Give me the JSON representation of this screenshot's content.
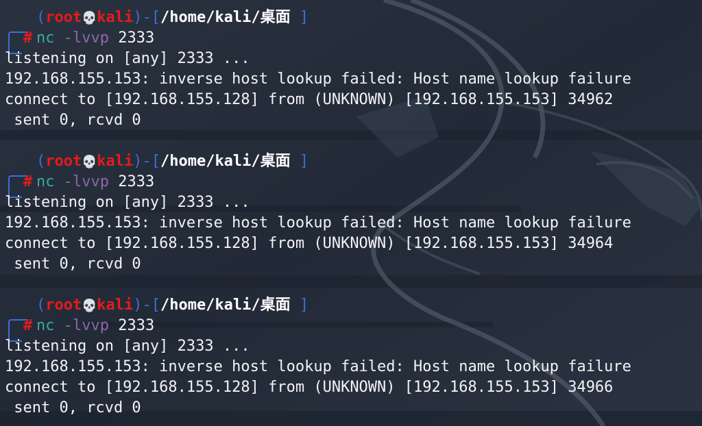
{
  "prompt": {
    "user": "root",
    "skull": "💀",
    "host": "kali",
    "path": "/home/kali/桌面",
    "symbol": "#"
  },
  "icons": {
    "skull": "skull-icon"
  },
  "colors": {
    "background": "#262e3c",
    "frame": "#3b6fd6",
    "user_host": "#e51b1b",
    "command": "#3aa7a7",
    "argument": "#8a6aa6",
    "text": "#f2f3f5"
  },
  "sessions": [
    {
      "command": "nc",
      "flag": "-lvvp",
      "port": "2333",
      "listening": "listening on [any] 2333 ...",
      "lookup": "192.168.155.153: inverse host lookup failed: Host name lookup failure",
      "connect": "connect to [192.168.155.128] from (UNKNOWN) [192.168.155.153] 34962",
      "sent": " sent 0, rcvd 0"
    },
    {
      "command": "nc",
      "flag": "-lvvp",
      "port": "2333",
      "listening": "listening on [any] 2333 ...",
      "lookup": "192.168.155.153: inverse host lookup failed: Host name lookup failure",
      "connect": "connect to [192.168.155.128] from (UNKNOWN) [192.168.155.153] 34964",
      "sent": " sent 0, rcvd 0"
    },
    {
      "command": "nc",
      "flag": "-lvvp",
      "port": "2333",
      "listening": "listening on [any] 2333 ...",
      "lookup": "192.168.155.153: inverse host lookup failed: Host name lookup failure",
      "connect": "connect to [192.168.155.128] from (UNKNOWN) [192.168.155.153] 34966",
      "sent": " sent 0, rcvd 0"
    }
  ]
}
